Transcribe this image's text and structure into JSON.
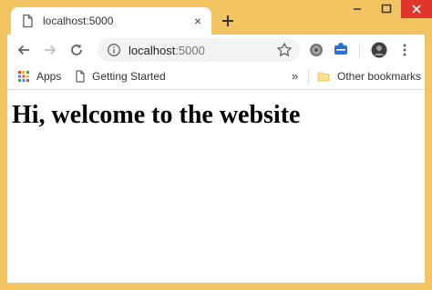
{
  "tab": {
    "title": "localhost:5000",
    "close": "×"
  },
  "window": {
    "minimize": "minimize",
    "maximize": "maximize",
    "close": "close"
  },
  "toolbar": {
    "url_host": "localhost",
    "url_port": ":5000"
  },
  "bookmarks": {
    "apps": "Apps",
    "getting_started": "Getting Started",
    "overflow": "»",
    "other": "Other bookmarks"
  },
  "page": {
    "heading": "Hi, welcome to the website"
  },
  "colors": {
    "frame": "#f3c562",
    "close_button": "#e0352b",
    "apps_grid": [
      "#ea4335",
      "#fbbc04",
      "#34a853",
      "#4285f4"
    ]
  },
  "icons": [
    "page-icon",
    "plus-icon",
    "minimize-icon",
    "maximize-icon",
    "close-icon",
    "back-icon",
    "forward-icon",
    "reload-icon",
    "info-icon",
    "star-icon",
    "extension-icon",
    "avatar-icon",
    "menu-icon",
    "apps-grid-icon",
    "folder-icon"
  ]
}
